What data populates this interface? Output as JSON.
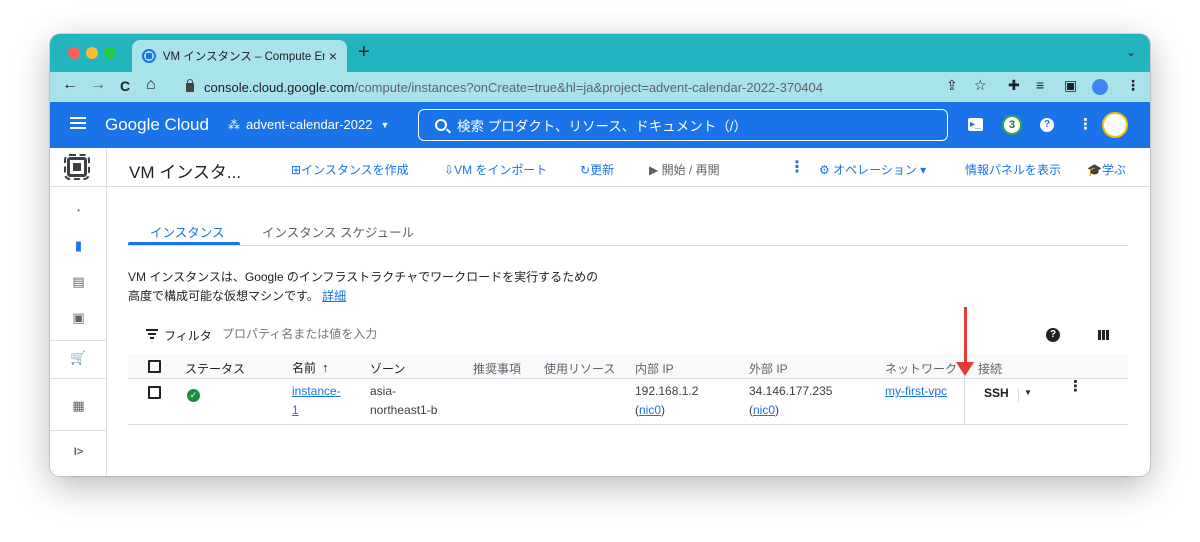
{
  "browser": {
    "tab_title": "VM インスタンス – Compute Engine",
    "tab_close": "×",
    "new_tab": "+",
    "tab_menu": "⌄",
    "back": "←",
    "forward": "→",
    "reload": "C",
    "home": "⌂",
    "url_host": "console.cloud.google.com",
    "url_path": "/compute/instances?onCreate=true&hl=ja&project=advent-calendar-2022-370404",
    "share": "⇪",
    "star": "☆",
    "extensions": "✚",
    "reading_list": "≡",
    "side_panel": "▣",
    "menu": "⋮"
  },
  "header": {
    "logo_text": "Google Cloud",
    "project_name": "advent-calendar-2022",
    "project_caret": "▼",
    "project_icon": "⁂",
    "search_placeholder": "検索 プロダクト、リソース、ドキュメント（/）",
    "cloud_shell": "▸_",
    "notifications_count": "3",
    "help": "?",
    "more": "⋮"
  },
  "rail": {
    "dot": "•",
    "instances": "▮",
    "templates": "▤",
    "groups": "▣",
    "marketplace": "🛒",
    "release_notes": "▦",
    "expand": "I>"
  },
  "toolbar": {
    "title": "VM インスタ...",
    "create_icon": "⊞",
    "create_label": "インスタンスを作成",
    "import_icon": "⇩",
    "import_label": "VM をインポート",
    "refresh_icon": "↻",
    "refresh_label": "更新",
    "start_label": "▶ 開始 / 再開",
    "more": "⋮",
    "operations_label": "⚙ オペレーション ▾",
    "info_panel_label": "情報パネルを表示",
    "learn_label": "🎓学ぶ"
  },
  "tabs": [
    {
      "label": "インスタンス",
      "active": true
    },
    {
      "label": "インスタンス スケジュール",
      "active": false
    }
  ],
  "description": {
    "line1": "VM インスタンスは、Google のインフラストラクチャでワークロードを実行するための",
    "line2": "高度で構成可能な仮想マシンです。",
    "link": "詳細"
  },
  "filter": {
    "label": "フィルタ",
    "placeholder": "プロパティ名または値を入力"
  },
  "table": {
    "headers": {
      "status": "ステータス",
      "name": "名前",
      "sort": "↑",
      "zone": "ゾーン",
      "recommendation": "推奨事項",
      "in_use_by": "使用リソース",
      "internal_ip": "内部 IP",
      "external_ip": "外部 IP",
      "network": "ネットワーク",
      "connect": "接続"
    },
    "rows": [
      {
        "status_icon": "✓",
        "name_line1": "instance-",
        "name_line2": "1",
        "zone_line1": "asia-",
        "zone_line2": "northeast1-b",
        "internal_ip": "192.168.1.2",
        "internal_nic": "nic0",
        "external_ip": "34.146.177.235",
        "external_nic": "nic0",
        "network": "my-first-vpc",
        "ssh": "SSH",
        "ssh_caret": "▼",
        "more": "⋮"
      }
    ]
  }
}
